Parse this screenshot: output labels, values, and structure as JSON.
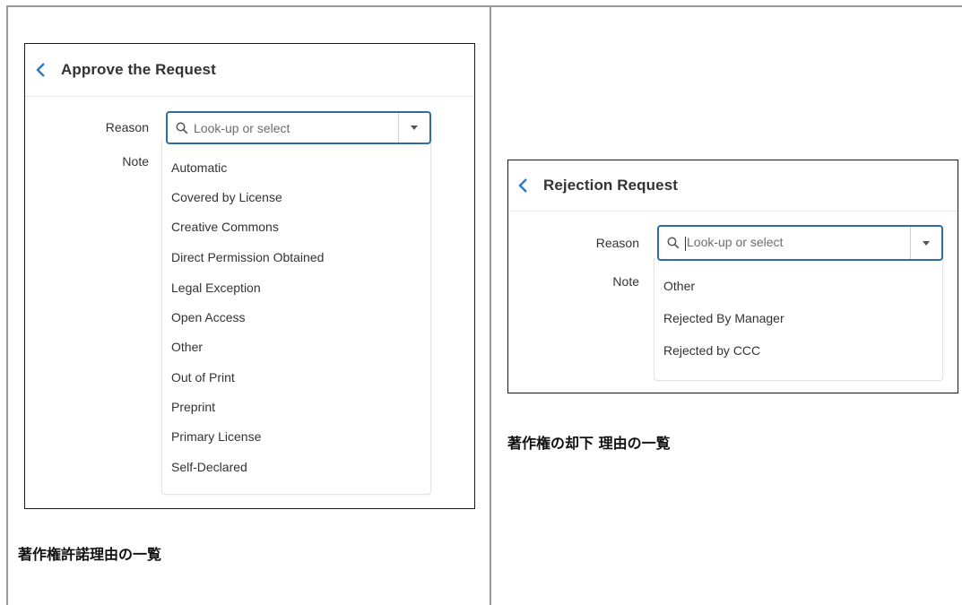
{
  "left_panel": {
    "title": "Approve the Request",
    "reason_label": "Reason",
    "note_label": "Note",
    "select_placeholder": "Look-up or select",
    "options": [
      "Automatic",
      "Covered by License",
      "Creative Commons",
      "Direct Permission Obtained",
      "Legal Exception",
      "Open Access",
      "Other",
      "Out of Print",
      "Preprint",
      "Primary License",
      "Self-Declared"
    ],
    "caption": "著作権許諾理由の一覧"
  },
  "right_panel": {
    "title": "Rejection Request",
    "reason_label": "Reason",
    "note_label": "Note",
    "select_placeholder": "Look-up or select",
    "options": [
      "Other",
      "Rejected By Manager",
      "Rejected by CCC"
    ],
    "caption": "著作権の却下 理由の一覧"
  },
  "colors": {
    "accent_blue": "#2c78c7",
    "select_border": "#2e6da4"
  },
  "icons": {
    "back": "chevron-left-icon",
    "search": "search-icon",
    "dropdown": "caret-down-icon"
  }
}
